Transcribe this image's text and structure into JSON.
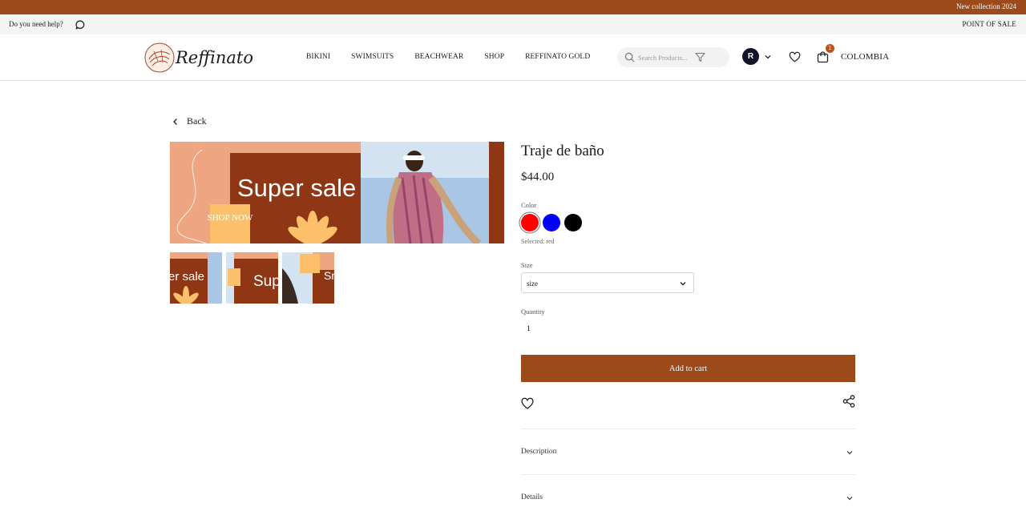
{
  "promo": {
    "text": "New collection 2024"
  },
  "help_bar": {
    "help_text": "Do you need help?",
    "point_of_sale": "POINT OF SALE"
  },
  "header": {
    "logo_text": "Reffinato",
    "nav": [
      "BIKINI",
      "SWIMSUITS",
      "BEACHWEAR",
      "SHOP",
      "REFFINATO GOLD"
    ],
    "search_placeholder": "Search Products...",
    "avatar_initial": "R",
    "cart_count": "1",
    "country": "COLOMBIA"
  },
  "back_label": "Back",
  "product": {
    "images": {
      "banner_text": "Super sale",
      "shop_now": "SHOP NOW",
      "thumb_1_text": "er sale",
      "thumb_2_text": "Sup",
      "thumb_3_text": "Sr"
    },
    "title": "Traje de baño",
    "price": "$44.00",
    "color_label": "Color",
    "colors": [
      {
        "name": "red",
        "hex": "#ff0000"
      },
      {
        "name": "blue",
        "hex": "#0000ff"
      },
      {
        "name": "black",
        "hex": "#000000"
      }
    ],
    "selected_color_text": "Selected: red",
    "size_label": "Size",
    "size_value": "size",
    "quantity_label": "Quantity",
    "quantity_value": "1",
    "add_to_cart": "Add to cart",
    "accordions": [
      "Description",
      "Details"
    ]
  },
  "colors": {
    "brand": "#9c4a1a",
    "badge": "#b8541f",
    "banner_bg": "#8f3715",
    "banner_peach": "#eea682",
    "banner_yellow": "#fdc06a"
  },
  "icons": [
    "chat-icon",
    "search-icon",
    "filter-icon",
    "chevron-down-icon",
    "heart-icon",
    "cart-icon",
    "chevron-left-icon",
    "share-icon"
  ]
}
